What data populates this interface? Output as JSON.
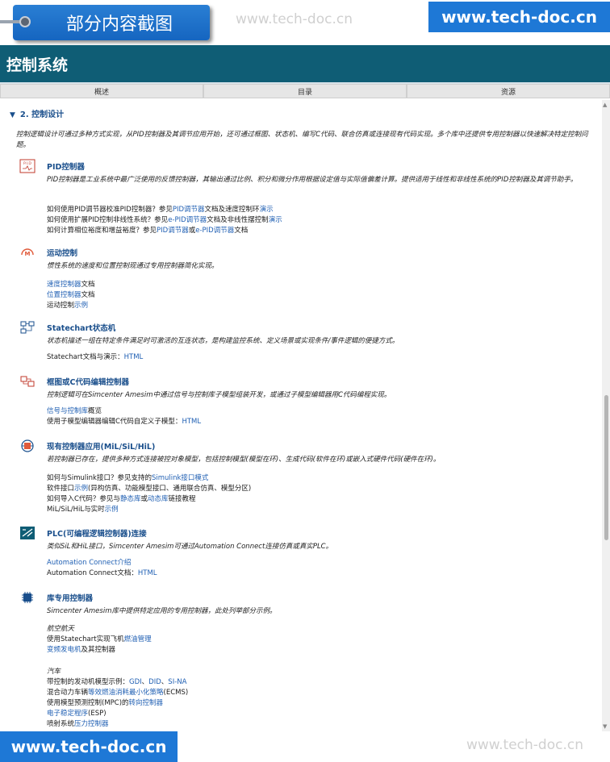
{
  "banner": {
    "partial_label": "部分内容截图",
    "watermark": "www.tech-doc.cn",
    "brand": "www.tech-doc.cn"
  },
  "app": {
    "title": "控制系统",
    "tabs": [
      "概述",
      "目录",
      "资源"
    ]
  },
  "section": {
    "triangle": "▼",
    "title": "2. 控制设计",
    "intro": "控制逻辑设计可通过多种方式实现，从PID控制器及其调节应用开始，还可通过框图、状态机、编写C代码、联合仿真或连接现有代码实现。多个库中还提供专用控制器以快速解决特定控制问题。"
  },
  "blocks": {
    "pid": {
      "icon": "pid-icon",
      "title": "PID控制器",
      "desc": "PID控制器是工业系统中最广泛使用的反馈控制器，其输出通过比例、积分和微分作用根据设定值与实际值偏差计算。提供适用于线性和非线性系统的PID控制器及其调节助手。",
      "l1a": "如何使用PID调节器校准PID控制器？参见",
      "l1b": "PID调节器",
      "l1c": "文档及速度控制环",
      "l1d": "演示",
      "l2a": "如何使用扩展PID控制非线性系统？参见",
      "l2b": "e-PID调节器",
      "l2c": "文档及非线性摆控制",
      "l2d": "演示",
      "l3a": "如何计算相位裕度和增益裕度？参见",
      "l3b": "PID调节器",
      "l3c": "或",
      "l3d": "e-PID调节器",
      "l3e": "文档"
    },
    "motion": {
      "icon": "motion-icon",
      "title": "运动控制",
      "desc": "惯性系统的速度和位置控制现通过专用控制器简化实现。",
      "l1a": "速度控制器",
      "l1b": "文档",
      "l2a": "位置控制器",
      "l2b": "文档",
      "l3a": "运动控制",
      "l3b": "示例"
    },
    "statechart": {
      "icon": "statechart-icon",
      "title": "Statechart状态机",
      "desc": "状态机描述一组在特定条件满足时可激活的互连状态，是构建监控系统、定义场景或实现条件/事件逻辑的便捷方式。",
      "l1a": "Statechart文档与演示：",
      "l1b": "HTML"
    },
    "blockdiagram": {
      "icon": "block-diagram-icon",
      "title": "框图或C代码编辑控制器",
      "desc": "控制逻辑可在Simcenter Amesim中通过信号与控制库子模型组装开发，或通过子模型编辑器用C代码编程实现。",
      "l1a": "信号与控制库",
      "l1b": "概览",
      "l2a": "使用子模型编辑器编辑C代码自定义子模型：",
      "l2b": "HTML"
    },
    "existing": {
      "icon": "mil-sil-hil-icon",
      "title": "现有控制器应用(MiL/SiL/HiL)",
      "desc": "若控制器已存在，提供多种方式连接被控对象模型，包括控制模型(模型在环)、生成代码(软件在环)或嵌入式硬件代码(硬件在环)。",
      "l1a": "如何与Simulink接口？参见支持的",
      "l1b": "Simulink接口模式",
      "l2a": "软件接口",
      "l2b": "示例",
      "l2c": "(异构仿真、功能模型接口、通用联合仿真、模型分区)",
      "l3a": "如何导入C代码？参见与",
      "l3b": "静态库",
      "l3c": "或",
      "l3d": "动态库",
      "l3e": "链接教程",
      "l4a": "MiL/SiL/HiL与实时",
      "l4b": "示例"
    },
    "plc": {
      "icon": "plc-icon",
      "title": "PLC(可编程逻辑控制器)连接",
      "desc": "类似SiL和HiL接口，Simcenter Amesim可通过Automation Connect连接仿真或真实PLC。",
      "l1a": "Automation Connect介绍",
      "l2a": "Automation Connect文档：",
      "l2b": "HTML"
    },
    "library": {
      "icon": "chip-icon",
      "title": "库专用控制器",
      "desc": "Simcenter Amesim库中提供特定应用的专用控制器，此处列举部分示例。",
      "g1": "航空航天",
      "a1a": "使用Statechart实现飞机",
      "a1b": "燃油管理",
      "a2a": "变频发电机",
      "a2b": "及其控制器",
      "g2": "汽车",
      "c1a": "带控制的发动机模型示例：",
      "c1b": "GDI",
      "c1c": "、",
      "c1d": "DID",
      "c1e": "、",
      "c1f": "SI-NA",
      "c2a": "混合动力车辆",
      "c2b": "等效燃油消耗最小化策略",
      "c2c": "(ECMS)",
      "c3a": "使用模型预测控制(MPC)的",
      "c3b": "转向控制器",
      "c4a": "电子稳定程序",
      "c4b": "(ESP)",
      "c5a": "喷射系统",
      "c5b": "压力控制器"
    }
  },
  "colors": {
    "header": "#0f5d75",
    "link": "#1f5fb3",
    "brand": "#1e78d6",
    "heading": "#1a4f8c"
  }
}
